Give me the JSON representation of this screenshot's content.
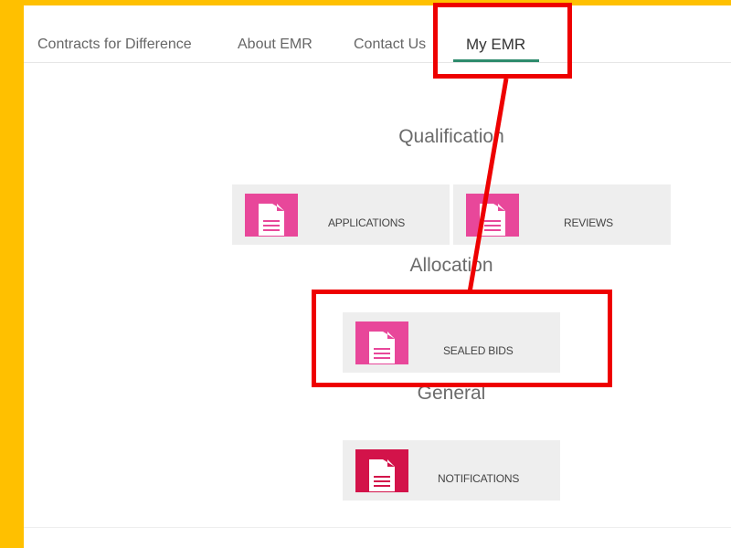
{
  "nav": {
    "items": [
      {
        "label": "Contracts for Difference"
      },
      {
        "label": "About EMR"
      },
      {
        "label": "Contact Us"
      },
      {
        "label": "My EMR",
        "active": true
      }
    ]
  },
  "sections": {
    "qualification": {
      "heading": "Qualification",
      "tiles": [
        {
          "label": "APPLICATIONS",
          "icon": "document-icon"
        },
        {
          "label": "REVIEWS",
          "icon": "document-icon"
        }
      ]
    },
    "allocation": {
      "heading": "Allocation",
      "tiles": [
        {
          "label": "SEALED BIDS",
          "icon": "document-icon"
        }
      ]
    },
    "general": {
      "heading": "General",
      "tiles": [
        {
          "label": "NOTIFICATIONS",
          "icon": "document-icon"
        }
      ]
    }
  },
  "colors": {
    "frame": "#ffc000",
    "accent_underline": "#2e8b6d",
    "icon_pink": "#e8479a",
    "icon_crimson": "#d3134a",
    "tile_bg": "#eeeeee",
    "annotation": "#ee0000"
  }
}
